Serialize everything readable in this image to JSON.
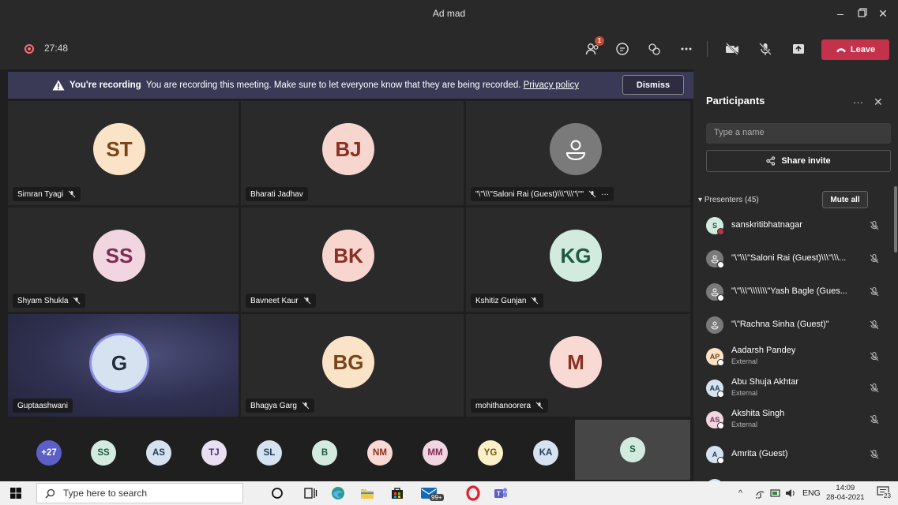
{
  "window": {
    "title": "Ad mad",
    "minimize": "–",
    "close": "✕"
  },
  "controls": {
    "timer": "27:48",
    "participants_badge": "1",
    "leave_label": "Leave"
  },
  "banner": {
    "bold": "You're recording",
    "text": "You are recording this meeting. Make sure to let everyone know that they are being recorded.",
    "link": "Privacy policy",
    "dismiss": "Dismiss"
  },
  "grid": {
    "tiles": [
      {
        "name": "Simran Tyagi",
        "initials": "ST",
        "color": "#fbe3c8",
        "fg": "#7a4416"
      },
      {
        "name": "Bharati Jadhav",
        "initials": "BJ",
        "color": "#f7d6d0",
        "fg": "#8a2f22"
      },
      {
        "name": "\"\\\"\\\\\\\"Saloni Rai (Guest)\\\\\\\"\\\\\\\"\\\"\"",
        "initials": "",
        "color": "#7a7a7a",
        "fg": "#ffffff",
        "more": "···"
      },
      {
        "name": "Shyam Shukla",
        "initials": "SS",
        "color": "#f1d6e2",
        "fg": "#7d2c52"
      },
      {
        "name": "Bavneet Kaur",
        "initials": "BK",
        "color": "#f7d6d0",
        "fg": "#8a2f22"
      },
      {
        "name": "Kshitiz Gunjan",
        "initials": "KG",
        "color": "#d3ebdf",
        "fg": "#1e5a40"
      },
      {
        "name": "Guptaashwani",
        "initials": "G",
        "color": "#d6e2f0",
        "fg": "#1f2d3d"
      },
      {
        "name": "Bhagya Garg",
        "initials": "BG",
        "color": "#fbe3c8",
        "fg": "#7a4416"
      },
      {
        "name": "mohithanoorera",
        "initials": "M",
        "color": "#f9d9d4",
        "fg": "#8a2f22"
      }
    ]
  },
  "strip": {
    "items": [
      {
        "label": "+27",
        "color": "#5b5fc7",
        "fg": "#ffffff"
      },
      {
        "label": "SS",
        "color": "#d3ebdf",
        "fg": "#1e5a40"
      },
      {
        "label": "AS",
        "color": "#d6e2f0",
        "fg": "#1f3a5c"
      },
      {
        "label": "TJ",
        "color": "#e9dff3",
        "fg": "#4e2f73"
      },
      {
        "label": "SL",
        "color": "#d6e2f0",
        "fg": "#1f3a5c"
      },
      {
        "label": "B",
        "color": "#d3ebdf",
        "fg": "#1e5a40"
      },
      {
        "label": "NM",
        "color": "#f9d9d4",
        "fg": "#8a2f22"
      },
      {
        "label": "MM",
        "color": "#f1d6e2",
        "fg": "#7d2c52"
      },
      {
        "label": "YG",
        "color": "#fbf0c8",
        "fg": "#6d5a12"
      },
      {
        "label": "KA",
        "color": "#d6e2f0",
        "fg": "#1f3a5c"
      }
    ],
    "self": {
      "label": "S",
      "color": "#d3ebdf",
      "fg": "#1e5a40"
    }
  },
  "panel": {
    "title": "Participants",
    "more": "···",
    "close": "✕",
    "search_placeholder": "Type a name",
    "share_invite": "Share invite",
    "section": "Presenters (45)",
    "mute_all": "Mute all",
    "people": [
      {
        "name": "sanskritibhatnagar",
        "sub": "",
        "initials": "S",
        "color": "#d3ebdf",
        "fg": "#1e5a40",
        "status": "#c4314b"
      },
      {
        "name": "\"\\\"\\\\\\\"Saloni Rai (Guest)\\\\\\\"\\\\\\...",
        "sub": "",
        "initials": "",
        "color": "#7a7a7a",
        "fg": "#ffffff",
        "status": "#ffffff"
      },
      {
        "name": "\"\\\"\\\\\\\"\\\\\\\\\\\\\\\"Yash Bagle (Gues...",
        "sub": "",
        "initials": "",
        "color": "#7a7a7a",
        "fg": "#ffffff",
        "status": "#ffffff"
      },
      {
        "name": "\"\\\"Rachna Sinha (Guest)\"",
        "sub": "",
        "initials": "",
        "color": "#7a7a7a",
        "fg": "#ffffff",
        "status": "#ffffff"
      },
      {
        "name": "Aadarsh Pandey",
        "sub": "External",
        "initials": "AP",
        "color": "#fbe3c8",
        "fg": "#7a4416",
        "status": "#ffffff"
      },
      {
        "name": "Abu Shuja Akhtar",
        "sub": "External",
        "initials": "AA",
        "color": "#d6e2f0",
        "fg": "#1f3a5c",
        "status": "#ffffff"
      },
      {
        "name": "Akshita Singh",
        "sub": "External",
        "initials": "AS",
        "color": "#f1d6e2",
        "fg": "#7d2c52",
        "status": "#ffffff"
      },
      {
        "name": "Amrita (Guest)",
        "sub": "",
        "initials": "A",
        "color": "#d6e2f0",
        "fg": "#1f3a5c",
        "status": "#ffffff"
      }
    ]
  },
  "taskbar": {
    "search_placeholder": "Type here to search",
    "badge": "99+",
    "lang": "ENG",
    "time": "14:09",
    "date": "28-04-2021",
    "notif": "23"
  }
}
